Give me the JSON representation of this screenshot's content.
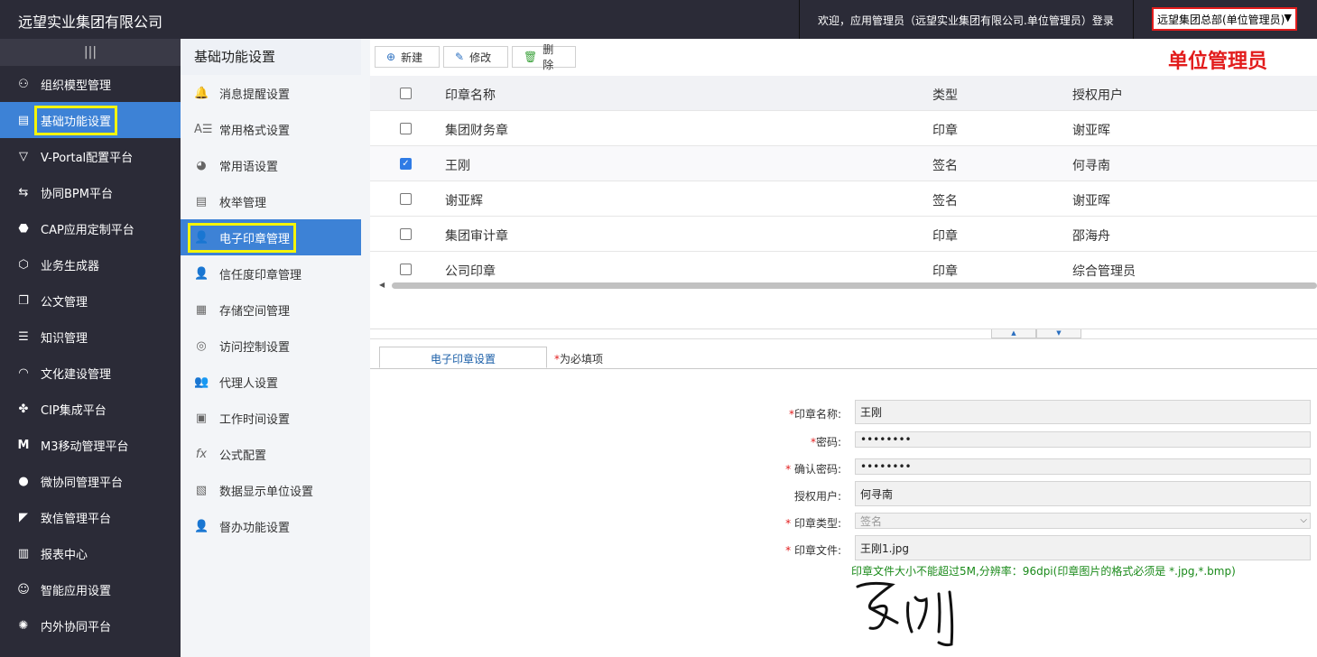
{
  "header": {
    "title": "远望实业集团有限公司",
    "welcome": "欢迎，应用管理员（远望实业集团有限公司.单位管理员）登录",
    "unit_select": "远望集团总部(单位管理员)"
  },
  "role_label": "单位管理员",
  "colors": {
    "nav_bg": "#2b2b37",
    "accent": "#3d82d6",
    "highlight": "#f5f509",
    "alert": "#e21c1c"
  },
  "nav": {
    "items": [
      {
        "label": "组织模型管理",
        "icon": "org-tree-icon"
      },
      {
        "label": "基础功能设置",
        "icon": "settings-panel-icon"
      },
      {
        "label": "V-Portal配置平台",
        "icon": "vportal-icon"
      },
      {
        "label": "协同BPM平台",
        "icon": "workflow-icon"
      },
      {
        "label": "CAP应用定制平台",
        "icon": "cap-icon"
      },
      {
        "label": "业务生成器",
        "icon": "cube-icon"
      },
      {
        "label": "公文管理",
        "icon": "document-icon"
      },
      {
        "label": "知识管理",
        "icon": "knowledge-icon"
      },
      {
        "label": "文化建设管理",
        "icon": "gauge-icon"
      },
      {
        "label": "CIP集成平台",
        "icon": "integration-icon"
      },
      {
        "label": "M3移动管理平台",
        "icon": "m3-icon"
      },
      {
        "label": "微协同管理平台",
        "icon": "wechat-icon"
      },
      {
        "label": "致信管理平台",
        "icon": "message-icon"
      },
      {
        "label": "报表中心",
        "icon": "report-icon"
      },
      {
        "label": "智能应用设置",
        "icon": "robot-icon"
      },
      {
        "label": "内外协同平台",
        "icon": "collab-icon"
      }
    ]
  },
  "subnav": {
    "title": "基础功能设置",
    "items": [
      {
        "label": "消息提醒设置",
        "icon": "bell-icon"
      },
      {
        "label": "常用格式设置",
        "icon": "format-icon"
      },
      {
        "label": "常用语设置",
        "icon": "chat-bubble-icon"
      },
      {
        "label": "枚举管理",
        "icon": "list-doc-icon"
      },
      {
        "label": "电子印章管理",
        "icon": "user-seal-icon"
      },
      {
        "label": "信任度印章管理",
        "icon": "user-icon"
      },
      {
        "label": "存储空间管理",
        "icon": "storage-icon"
      },
      {
        "label": "访问控制设置",
        "icon": "access-icon"
      },
      {
        "label": "代理人设置",
        "icon": "agent-icon"
      },
      {
        "label": "工作时间设置",
        "icon": "monitor-clock-icon"
      },
      {
        "label": "公式配置",
        "icon": "formula-icon"
      },
      {
        "label": "数据显示单位设置",
        "icon": "data-unit-icon"
      },
      {
        "label": "督办功能设置",
        "icon": "supervise-icon"
      }
    ]
  },
  "toolbar": {
    "new_label": "新建",
    "edit_label": "修改",
    "delete_label": "删除"
  },
  "table": {
    "headers": [
      "印章名称",
      "类型",
      "授权用户"
    ],
    "rows": [
      {
        "name": "集团财务章",
        "type": "印章",
        "user": "谢亚晖",
        "checked": false
      },
      {
        "name": "王刚",
        "type": "签名",
        "user": "何寻南",
        "checked": true
      },
      {
        "name": "谢亚辉",
        "type": "签名",
        "user": "谢亚晖",
        "checked": false
      },
      {
        "name": "集团审计章",
        "type": "印章",
        "user": "邵海舟",
        "checked": false
      },
      {
        "name": "公司印章",
        "type": "印章",
        "user": "综合管理员",
        "checked": false
      }
    ]
  },
  "form": {
    "tab_label": "电子印章设置",
    "required_note": "为必填项",
    "fields": [
      {
        "label": "印章名称:",
        "value": "王刚",
        "required": true
      },
      {
        "label": "密码:",
        "value": "••••••••",
        "required": true
      },
      {
        "label": "确认密码:",
        "value": "••••••••",
        "required": true
      },
      {
        "label": "授权用户:",
        "value": "何寻南",
        "required": false
      },
      {
        "label": "印章类型:",
        "value": "签名",
        "required": true
      },
      {
        "label": "印章文件:",
        "value": "王刚1.jpg",
        "required": true
      }
    ],
    "hint": "印章文件大小不能超过5M,分辨率：96dpi(印章图片的格式必须是 *.jpg,*.bmp)"
  }
}
